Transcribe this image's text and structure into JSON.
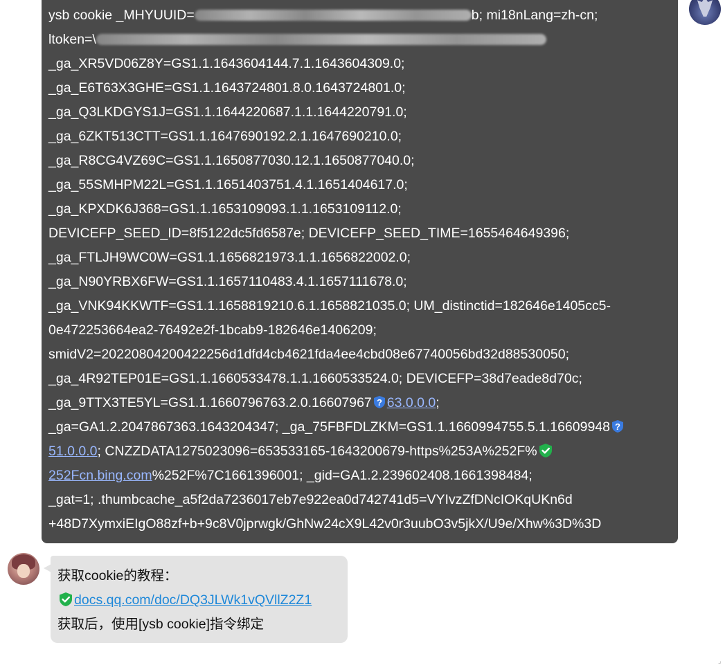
{
  "sent": {
    "lines": [
      [
        "ysb cookie _MHYUUID=",
        "b; mi18nLang=zh-cn;"
      ],
      [
        "ltoken=\\"
      ],
      "_ga_XR5VD06Z8Y=GS1.1.1643604144.7.1.1643604309.0;",
      "_ga_E6T63X3GHE=GS1.1.1643724801.8.0.1643724801.0;",
      "_ga_Q3LKDGYS1J=GS1.1.1644220687.1.1.1644220791.0;",
      "_ga_6ZKT513CTT=GS1.1.1647690192.2.1.1647690210.0;",
      "_ga_R8CG4VZ69C=GS1.1.1650877030.12.1.1650877040.0;",
      "_ga_55SMHPM22L=GS1.1.1651403751.4.1.1651404617.0;",
      "_ga_KPXDK6J368=GS1.1.1653109093.1.1.1653109112.0;",
      "DEVICEFP_SEED_ID=8f5122dc5fd6587e; DEVICEFP_SEED_TIME=1655464649396;",
      "_ga_FTLJH9WC0W=GS1.1.1656821973.1.1.1656822002.0;",
      "_ga_N90YRBX6FW=GS1.1.1657110483.4.1.1657111678.0;",
      "_ga_VNK94KKWTF=GS1.1.1658819210.6.1.1658821035.0; UM_distinctid=182646e1405cc5-",
      "0e472253664ea2-76492e2f-1bcab9-182646e1406209;",
      "smidV2=20220804200422256d1dfd4cb4621fda4ee4cbd08e67740056bd32d88530050;",
      "_ga_4R92TEP01E=GS1.1.1660533478.1.1.1660533524.0; DEVICEFP=38d7eade8d70c;",
      [
        "_ga_9TTX3TE5YL=GS1.1.1660796763.2.0.16607967",
        "63.0.0.0",
        ";"
      ],
      [
        "_ga=GA1.2.2047867363.1643204347; _ga_75FBFDLZKM=GS1.1.1660994755.5.1.16609948"
      ],
      [
        "51.0.0.0",
        "; CNZZDATA1275023096=653533165-1643200679-https%253A%252F%"
      ],
      [
        "252Fcn.bing.com",
        "%252F%7C1661396001; _gid=GA1.2.239602408.1661398484;"
      ],
      "_gat=1; .thumbcache_a5f2da7236017eb7e922ea0d742741d5=VYIvzZfDNcIOKqUKn6d",
      "+48D7XymxiEIgO88zf+b+9c8V0jprwgk/GhNw24cX9L42v0r3uubO3v5jkX/U9e/Xhw%3D%3D"
    ]
  },
  "received": {
    "line1": "获取cookie的教程：",
    "link": "docs.qq.com/doc/DQ3JLWk1vQVllZ2Z1",
    "line3": "获取后，使用[ysb cookie]指令绑定"
  },
  "colors": {
    "sent_bubble": "#4a4a4a",
    "received_bubble": "#e3e3e3",
    "link_dark": "#9ab8ff",
    "link_light": "#1e88d9",
    "shield_blue": "#3a7be0",
    "shield_green": "#22b14c"
  },
  "icons": [
    "question-shield-icon",
    "check-shield-icon"
  ]
}
